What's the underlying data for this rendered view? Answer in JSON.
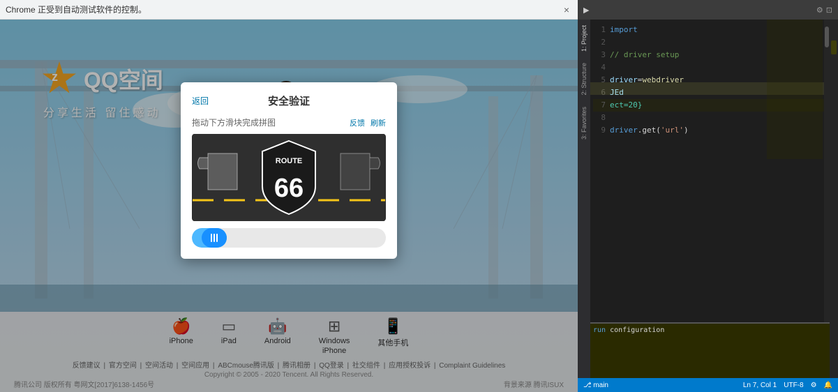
{
  "browser": {
    "warning_text": "Chrome 正受到自动测试软件的控制。",
    "close_button": "×"
  },
  "qq_space": {
    "logo_letter": "z",
    "title": "QQ空间",
    "slogan": "分享生活   留住感动",
    "app_icons": [
      {
        "icon": "🍎",
        "label": "iPhone"
      },
      {
        "icon": "⬜",
        "label": "iPad"
      },
      {
        "icon": "🤖",
        "label": "Android"
      },
      {
        "icon": "⊞",
        "label": "Windows\niPhone"
      },
      {
        "icon": "📱",
        "label": "其他手机"
      }
    ],
    "footer_links": [
      "反馈建议",
      "官方空间",
      "空间活动",
      "空间应用",
      "ABCmouse腾讯版",
      "腾讯相册",
      "QQ登录",
      "社交组件",
      "应用授权投诉",
      "Complaint Guidelines"
    ],
    "copyright": "Copyright © 2005 - 2020 Tencent. All Rights Reserved.",
    "icp": "腾讯公司 版权所有 粤网文[2017]6138-1456号",
    "brand_links": "背景来源  腾讯ISUX"
  },
  "dialog": {
    "title": "安全验证",
    "back_button": "返回",
    "instruction": "拖动下方滑块完成拼图",
    "refresh_link": "反馈",
    "help_link": "刷新",
    "route66_text": "ROUTE",
    "route66_number": "66",
    "slider_icon": "|||"
  },
  "editor": {
    "tabs": [
      "1: Project",
      "2: Structure",
      "3: Favorites"
    ],
    "code_line_code": "ect=20}",
    "highlight_text": "JEd"
  }
}
